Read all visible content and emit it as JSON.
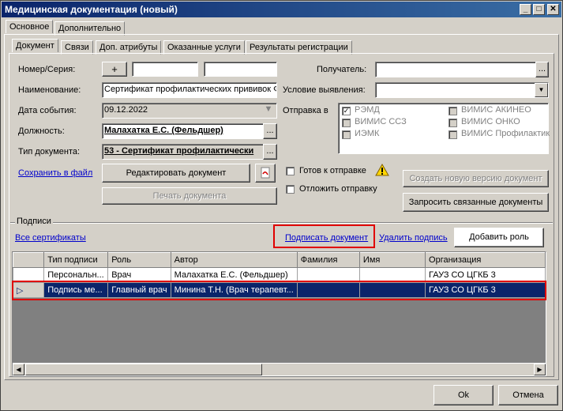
{
  "window": {
    "title": "Медицинская документация (новый)"
  },
  "outer_tabs": [
    "Основное",
    "Дополнительно"
  ],
  "inner_tabs": [
    "Документ",
    "Связи",
    "Доп. атрибуты",
    "Оказанные услуги",
    "Результаты регистрации"
  ],
  "form": {
    "number_label": "Номер/Серия:",
    "plus": "+",
    "name_label": "Наименование:",
    "name_value": "Сертификат профилактических прививок Ф",
    "date_label": "Дата события:",
    "date_value": "09.12.2022",
    "position_label": "Должность:",
    "position_value": "Малахатка Е.С. (Фельдшер)",
    "doctype_label": "Тип документа:",
    "doctype_value": "53 - Сертификат профилактически",
    "ellipsis": "...",
    "save_file": "Сохранить в файл",
    "edit_doc": "Редактировать документ",
    "print_doc": "Печать документа",
    "recipient_label": "Получатель:",
    "condition_label": "Условие выявления:",
    "send_to_label": "Отправка в",
    "send_targets": [
      {
        "label": "РЭМД",
        "checked": true
      },
      {
        "label": "ВИМИС АКИНЕО",
        "checked": false
      },
      {
        "label": "ВИМИС ССЗ",
        "checked": false
      },
      {
        "label": "ВИМИС ОНКО",
        "checked": false
      },
      {
        "label": "ИЭМК",
        "checked": false
      },
      {
        "label": "ВИМИС Профилактик",
        "checked": false
      }
    ],
    "ready_label": "Готов к отправке",
    "postpone_label": "Отложить отправку",
    "new_version": "Создать новую версию документ",
    "request_related": "Запросить связанные документы"
  },
  "signatures": {
    "group_label": "Подписи",
    "all_certs": "Все сертификаты",
    "sign_doc": "Подписать документ",
    "delete_sign": "Удалить подпись",
    "add_role": "Добавить роль",
    "columns": [
      "Тип подписи",
      "Роль",
      "Автор",
      "Фамилия",
      "Имя",
      "Организация"
    ],
    "rows": [
      [
        "Персональн...",
        "Врач",
        "Малахатка Е.С. (Фельдшер)",
        "",
        "",
        "ГАУЗ СО ЦГКБ 3"
      ],
      [
        "Подпись ме...",
        "Главный врач",
        "Минина Т.Н. (Врач терапевт...",
        "",
        "",
        "ГАУЗ СО ЦГКБ 3"
      ]
    ]
  },
  "footer": {
    "ok": "Ok",
    "cancel": "Отмена"
  }
}
